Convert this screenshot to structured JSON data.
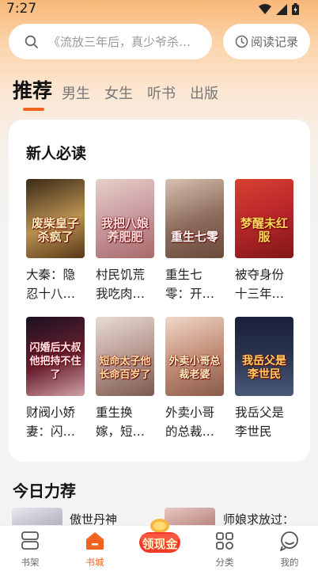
{
  "status": {
    "time": "7:27"
  },
  "search": {
    "placeholder": "《流放三年后，真少爷杀…",
    "history_label": "阅读记录"
  },
  "tabs": [
    {
      "label": "推荐",
      "active": true
    },
    {
      "label": "男生",
      "active": false
    },
    {
      "label": "女生",
      "active": false
    },
    {
      "label": "听书",
      "active": false
    },
    {
      "label": "出版",
      "active": false
    }
  ],
  "section_new": {
    "title": "新人必读",
    "books": [
      {
        "title": "大秦：隐忍十八…",
        "cover_text": "废柴皇子杀疯了",
        "cover_color": "#7a5a2a"
      },
      {
        "title": "村民饥荒我吃肉…",
        "cover_text": "我把八娘养肥肥",
        "cover_color": "#c8a2a6"
      },
      {
        "title": "重生七零：开…",
        "cover_text": "重生七零",
        "cover_color": "#9a7868"
      },
      {
        "title": "被夺身份十三年…",
        "cover_text": "梦醒未红服",
        "cover_color": "#b8262a"
      },
      {
        "title": "财阀小娇妻：闪…",
        "cover_text": "闪婚后大叔他把持不住了",
        "cover_color": "#6a2030"
      },
      {
        "title": "重生换嫁，短…",
        "cover_text": "短命太子他长命百岁了",
        "cover_color": "#b89a92"
      },
      {
        "title": "外卖小哥的总裁…",
        "cover_text": "外卖小哥总裁老婆",
        "cover_color": "#c4907a"
      },
      {
        "title": "我岳父是李世民",
        "cover_text": "我岳父是李世民",
        "cover_color": "#2a3550"
      }
    ]
  },
  "section_today": {
    "title": "今日力荐",
    "books": [
      {
        "title": "傲世丹神",
        "cover_color": "#c9c9d6"
      },
      {
        "title": "师娘求放过：",
        "cover_color": "#d4a6a0"
      }
    ]
  },
  "bottom_nav": [
    {
      "label": "书架",
      "icon": "bookshelf-icon",
      "active": false
    },
    {
      "label": "书城",
      "icon": "home-icon",
      "active": true
    },
    {
      "label": "领现金",
      "icon": "gold-coin-icon",
      "active": false
    },
    {
      "label": "分类",
      "icon": "category-grid-icon",
      "active": false
    },
    {
      "label": "我的",
      "icon": "profile-icon",
      "active": false
    }
  ],
  "colors": {
    "accent": "#f06420",
    "header_top": "#f8b878",
    "background": "#f3f3f3"
  }
}
